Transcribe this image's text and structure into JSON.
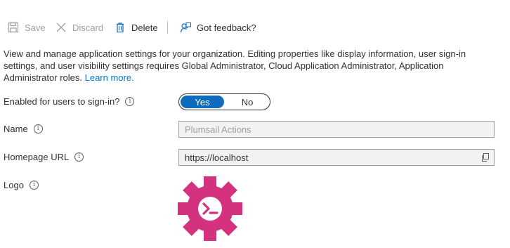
{
  "toolbar": {
    "save_label": "Save",
    "discard_label": "Discard",
    "delete_label": "Delete",
    "feedback_label": "Got feedback?"
  },
  "description": {
    "text": "View and manage application settings for your organization. Editing properties like display information, user sign-in settings, and user visibility settings requires Global Administrator, Cloud Application Administrator, Application Administrator roles.",
    "link": "Learn more."
  },
  "form": {
    "enabled_label": "Enabled for users to sign-in?",
    "enabled_yes": "Yes",
    "enabled_no": "No",
    "enabled_value": "Yes",
    "name_label": "Name",
    "name_value": "Plumsail Actions",
    "homepage_label": "Homepage URL",
    "homepage_value": "https://localhost",
    "logo_label": "Logo"
  },
  "icons": {
    "save": "save-icon",
    "discard": "close-icon",
    "delete": "trash-icon",
    "feedback": "feedback-icon",
    "info": "info-icon",
    "copy": "copy-icon",
    "logo": "gear-terminal-logo"
  },
  "colors": {
    "accent": "#0f6cbd",
    "link": "#0078d4",
    "logo": "#d4327e"
  }
}
